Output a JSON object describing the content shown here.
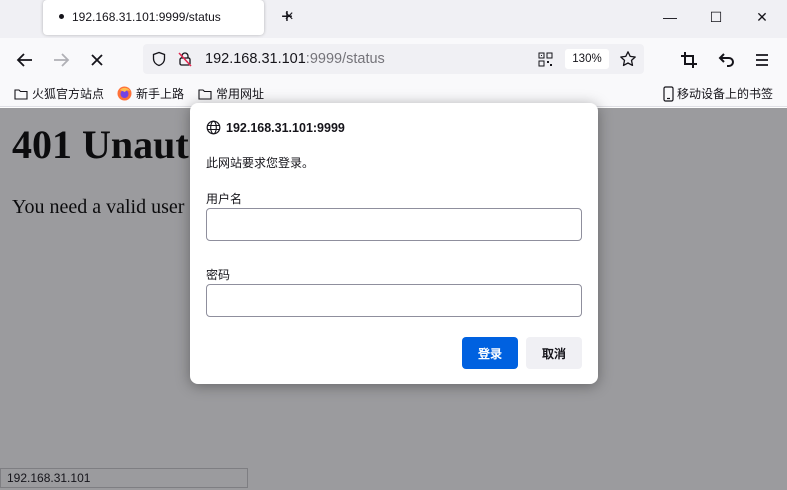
{
  "browser": {
    "tab": {
      "title": "192.168.31.101:9999/status"
    },
    "window_controls": {
      "minimize": "—",
      "maximize": "☐",
      "close": "✕"
    },
    "url": {
      "host": "192.168.31.101",
      "rest": ":9999/status"
    },
    "zoom": "130%"
  },
  "bookmarks": [
    {
      "label": "火狐官方站点",
      "icon": "folder-icon"
    },
    {
      "label": "新手上路",
      "icon": "firefox-icon"
    },
    {
      "label": "常用网址",
      "icon": "folder-icon"
    }
  ],
  "mobile_bookmarks": "移动设备上的书签",
  "page": {
    "heading": "401 Unaut",
    "text": "You need a valid user"
  },
  "status_text": "192.168.31.101",
  "dialog": {
    "host": "192.168.31.101:9999",
    "message": "此网站要求您登录。",
    "username_label": "用户名",
    "username_value": "",
    "password_label": "密码",
    "password_value": "",
    "login_button": "登录",
    "cancel_button": "取消"
  },
  "colors": {
    "accent": "#0061e0",
    "overlay": "#9b9b9e"
  }
}
